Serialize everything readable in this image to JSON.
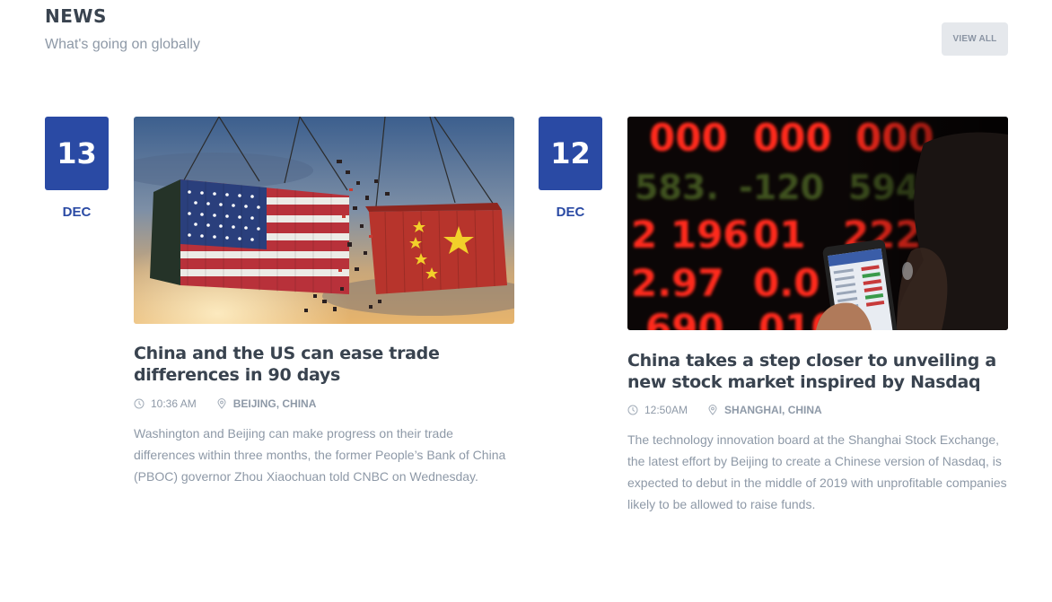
{
  "header": {
    "title": "NEWS",
    "subtitle": "What's going on globally",
    "view_all_label": "VIEW ALL"
  },
  "articles": [
    {
      "day": "13",
      "month": "DEC",
      "title": "China and the US can ease trade differences in 90 days",
      "time": "10:36 AM",
      "location": "BEIJING, CHINA",
      "excerpt": "Washington and Beijing can make progress on their trade differences within three months, the former People’s Bank of China (PBOC) governor Zhou Xiaochuan told CNBC on Wednesday.",
      "image_icon": "trade-war-containers-image"
    },
    {
      "day": "12",
      "month": "DEC",
      "title": "China takes a step closer to unveiling a new stock market inspired by Nasdaq",
      "time": "12:50AM",
      "location": "SHANGHAI, CHINA",
      "excerpt": "The technology innovation board at the Shanghai Stock Exchange, the latest effort by Beijing to create a Chinese version of Nasdaq, is expected to debut in the middle of 2019 with unprofitable companies likely to be allowed to raise funds.",
      "image_icon": "stock-ticker-image"
    }
  ],
  "colors": {
    "accent": "#2a4aa4",
    "muted_text": "#8e99a7",
    "heading_text": "#39434f",
    "button_bg": "#e5e8ec"
  }
}
